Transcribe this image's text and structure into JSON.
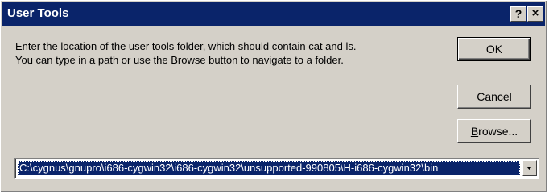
{
  "window": {
    "title": "User Tools",
    "help_glyph": "?",
    "close_glyph": "×",
    "colors": {
      "titlebar": "#0a246a",
      "face": "#d4d0c8",
      "selection": "#0a246a"
    }
  },
  "message": {
    "line1": "Enter the location of the user tools folder, which should contain cat and ls.",
    "line2": "You can type in a path or use the Browse button to navigate to a folder."
  },
  "buttons": {
    "ok": "OK",
    "cancel": "Cancel",
    "browse_accel": "B",
    "browse_rest": "rowse..."
  },
  "path_combo": {
    "value": "C:\\cygnus\\gnupro\\i686-cygwin32\\i686-cygwin32\\unsupported-990805\\H-i686-cygwin32\\bin",
    "icon": "chevron-down-icon"
  }
}
